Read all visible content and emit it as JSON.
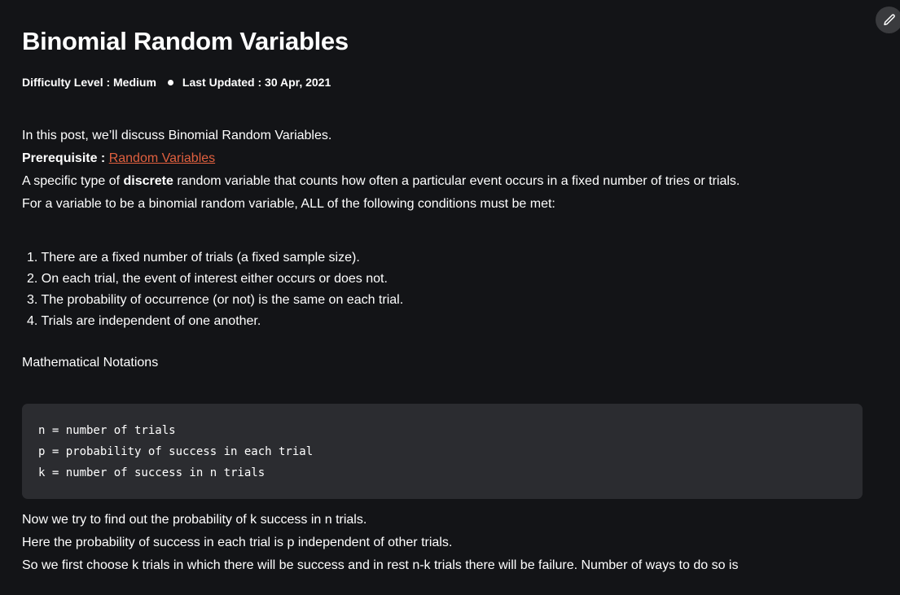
{
  "article": {
    "title": "Binomial Random Variables",
    "difficulty": "Difficulty Level : Medium",
    "last_updated": "Last Updated : 30 Apr, 2021"
  },
  "intro": {
    "line1": "In this post, we’ll discuss Binomial Random Variables.",
    "prereq_label": "Prerequisite : ",
    "prereq_link": "Random Variables ",
    "def_before": "A specific type of ",
    "def_bold": "discrete",
    "def_after": " random variable that counts how often a particular event occurs in a fixed number of tries or trials.",
    "conditions_intro": "For a variable to be a binomial random variable, ALL of the following conditions must be met:"
  },
  "conditions": [
    "1. There are a fixed number of trials (a fixed sample size).",
    "2. On each trial, the event of interest either occurs or does not.",
    "3. The probability of occurrence (or not) is the same on each trial.",
    "4. Trials are independent of one another."
  ],
  "notation_heading": "Mathematical Notations",
  "code": [
    "n = number of trials",
    "p = probability of success in each trial",
    "k = number of success in n trials"
  ],
  "after": [
    "Now we try to find out the probability of k success in n trials.",
    "Here the probability of success in each trial is p independent of other trials.",
    "So we first choose k trials in which there will be success and in rest n-k trials there will be failure. Number of ways to do so is"
  ],
  "icons": {
    "edit": "pencil-icon"
  },
  "colors": {
    "background": "#131417",
    "text": "#ffffff",
    "link": "#e0603f",
    "code_background": "#2b2c30"
  }
}
